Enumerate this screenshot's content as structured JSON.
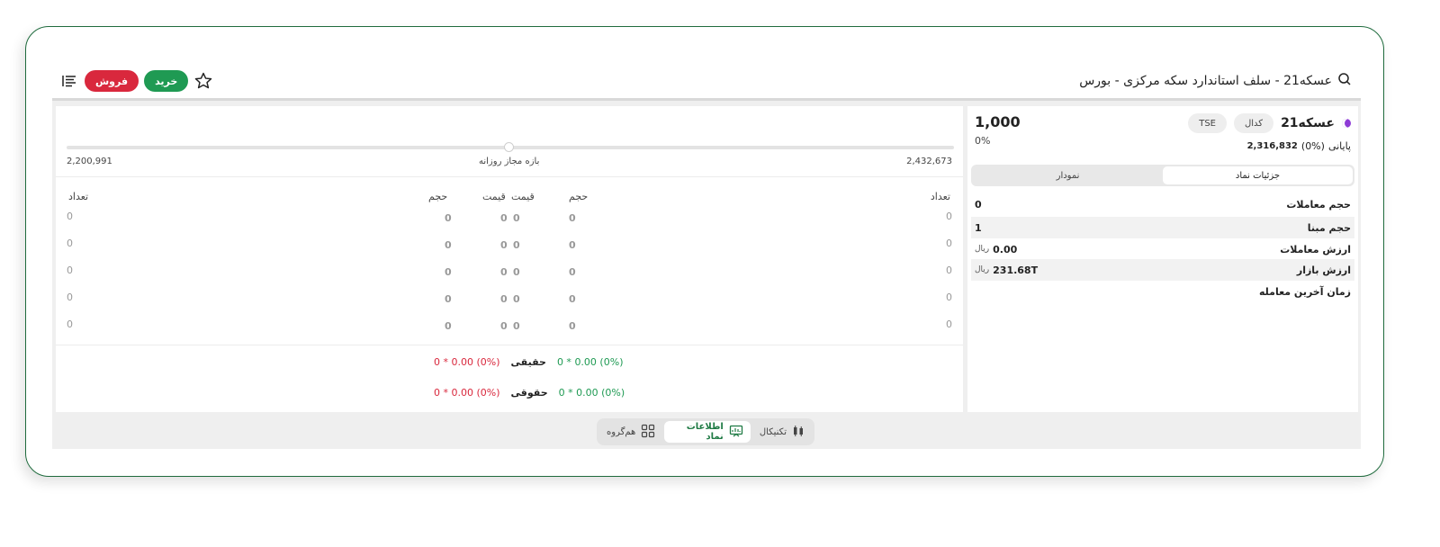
{
  "header": {
    "title": "عسکه21 - سلف استاندارد سکه مرکزی - بورس",
    "sell_label": "فروش",
    "buy_label": "خرید"
  },
  "range": {
    "min": "2,200,991",
    "max": "2,432,673",
    "label": "بازه مجاز روزانه"
  },
  "orderbook": {
    "headers": {
      "buy_count": "تعداد",
      "buy_volume": "حجم",
      "buy_price": "قیمت",
      "sell_price": "قیمت",
      "sell_volume": "حجم",
      "sell_count": "تعداد"
    },
    "rows": [
      {
        "buy_count": "0",
        "buy_volume": "0",
        "buy_price": "0",
        "sell_price": "0",
        "sell_volume": "0",
        "sell_count": "0"
      },
      {
        "buy_count": "0",
        "buy_volume": "0",
        "buy_price": "0",
        "sell_price": "0",
        "sell_volume": "0",
        "sell_count": "0"
      },
      {
        "buy_count": "0",
        "buy_volume": "0",
        "buy_price": "0",
        "sell_price": "0",
        "sell_volume": "0",
        "sell_count": "0"
      },
      {
        "buy_count": "0",
        "buy_volume": "0",
        "buy_price": "0",
        "sell_price": "0",
        "sell_volume": "0",
        "sell_count": "0"
      },
      {
        "buy_count": "0",
        "buy_volume": "0",
        "buy_price": "0",
        "sell_price": "0",
        "sell_volume": "0",
        "sell_count": "0"
      }
    ]
  },
  "legal": {
    "row1_label": "حقیقی",
    "row2_label": "حقوقی",
    "buy_text": "(0%) 0.00 * 0",
    "sell_text": "(0%) 0.00 * 0"
  },
  "symbol": {
    "name": "عسکه21",
    "code_chip": "کدال",
    "market_chip": "TSE",
    "last_price": "1,000",
    "last_pct": "0%",
    "final_label": "پایانی",
    "final_pct": "(0%)",
    "final_value": "2,316,832"
  },
  "detail_tabs": {
    "details": "جزئیات نماد",
    "chart": "نمودار"
  },
  "info": {
    "volume_label": "حجم معاملات",
    "volume_value": "0",
    "base_label": "حجم مبنا",
    "base_value": "1",
    "value_label": "ارزش معاملات",
    "value_value": "0.00",
    "value_unit": "ریال",
    "mcap_label": "ارزش بازار",
    "mcap_value": "231.68T",
    "mcap_unit": "ریال",
    "last_time_label": "زمان آخرین معامله"
  },
  "bottom_tabs": {
    "technical": "تکنیکال",
    "symbol_info": "اطلاعات نماد",
    "peer_group": "هم‌گروه"
  },
  "colors": {
    "buy": "#1f9a53",
    "sell": "#d9283d",
    "frame": "#1f6b3d"
  }
}
